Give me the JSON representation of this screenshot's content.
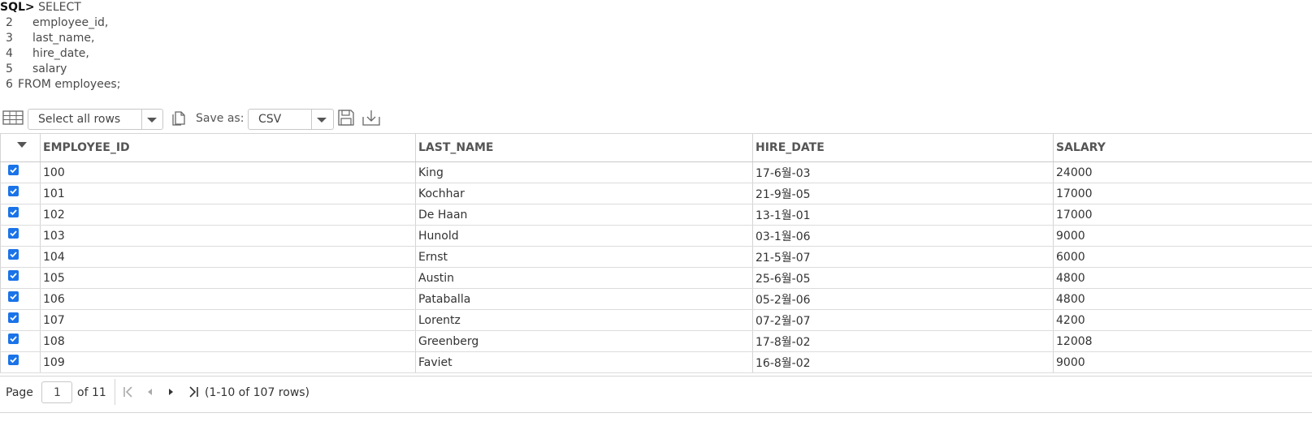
{
  "sql": {
    "prompt": "SQL>",
    "lines": [
      {
        "num": "",
        "text": "SELECT"
      },
      {
        "num": "2",
        "text": "employee_id,"
      },
      {
        "num": "3",
        "text": "last_name,"
      },
      {
        "num": "4",
        "text": "hire_date,"
      },
      {
        "num": "5",
        "text": "salary"
      },
      {
        "num": "6",
        "text": "FROM employees;"
      }
    ]
  },
  "toolbar": {
    "select_rows_value": "Select all rows",
    "save_as_label": "Save as:",
    "format_value": "CSV"
  },
  "grid": {
    "columns": [
      "EMPLOYEE_ID",
      "LAST_NAME",
      "HIRE_DATE",
      "SALARY"
    ],
    "rows": [
      [
        "100",
        "King",
        "17-6월-03",
        "24000"
      ],
      [
        "101",
        "Kochhar",
        "21-9월-05",
        "17000"
      ],
      [
        "102",
        "De Haan",
        "13-1월-01",
        "17000"
      ],
      [
        "103",
        "Hunold",
        "03-1월-06",
        "9000"
      ],
      [
        "104",
        "Ernst",
        "21-5월-07",
        "6000"
      ],
      [
        "105",
        "Austin",
        "25-6월-05",
        "4800"
      ],
      [
        "106",
        "Pataballa",
        "05-2월-06",
        "4800"
      ],
      [
        "107",
        "Lorentz",
        "07-2월-07",
        "4200"
      ],
      [
        "108",
        "Greenberg",
        "17-8월-02",
        "12008"
      ],
      [
        "109",
        "Faviet",
        "16-8월-02",
        "9000"
      ]
    ],
    "checked": [
      true,
      true,
      true,
      true,
      true,
      true,
      true,
      true,
      true,
      true
    ],
    "checkbox_color": "#1a73e8"
  },
  "pager": {
    "page_label": "Page",
    "current_page": "1",
    "of_label": "of 11",
    "range_text": "(1-10 of 107 rows)"
  }
}
